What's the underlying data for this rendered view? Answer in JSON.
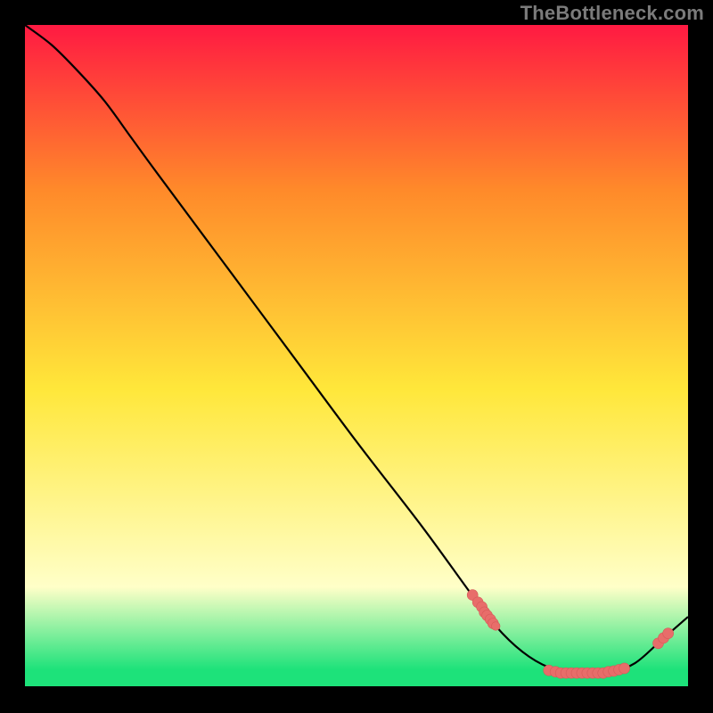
{
  "watermark": "TheBottleneck.com",
  "colors": {
    "background": "#000000",
    "gradient_top": "#ff1a42",
    "gradient_mid_upper": "#ff8a2a",
    "gradient_mid": "#ffe73a",
    "gradient_pale_yellow": "#ffffc8",
    "gradient_green": "#1de27a",
    "line": "#000000",
    "point_fill": "#e86d6a",
    "point_stroke": "#d65a58",
    "watermark": "#7b7b7b"
  },
  "chart_data": {
    "type": "line",
    "title": "",
    "xlabel": "",
    "ylabel": "",
    "xlim": [
      0,
      100
    ],
    "ylim": [
      0,
      100
    ],
    "grid": false,
    "legend": false,
    "series": [
      {
        "name": "curve",
        "x": [
          0,
          4,
          8,
          12,
          16,
          20,
          30,
          40,
          50,
          60,
          68,
          72,
          76,
          80,
          84,
          88,
          92,
          96,
          100
        ],
        "y": [
          100,
          97,
          93,
          88.5,
          83,
          77.5,
          64,
          50.5,
          37,
          24,
          13,
          8,
          4.5,
          2.5,
          2,
          2,
          3.5,
          7,
          10.5
        ]
      }
    ],
    "points": [
      {
        "x": 67.5,
        "y": 13.8,
        "r": 1.0
      },
      {
        "x": 68.3,
        "y": 12.7,
        "r": 1.0
      },
      {
        "x": 68.9,
        "y": 12.0,
        "r": 1.0
      },
      {
        "x": 69.3,
        "y": 11.2,
        "r": 1.0
      },
      {
        "x": 69.7,
        "y": 10.7,
        "r": 1.0
      },
      {
        "x": 70.2,
        "y": 10.1,
        "r": 1.0
      },
      {
        "x": 70.6,
        "y": 9.5,
        "r": 1.0
      },
      {
        "x": 71.0,
        "y": 9.1,
        "r": 0.8
      },
      {
        "x": 79.0,
        "y": 2.4,
        "r": 1.0
      },
      {
        "x": 80.0,
        "y": 2.2,
        "r": 1.0
      },
      {
        "x": 80.8,
        "y": 2.0,
        "r": 1.0
      },
      {
        "x": 81.6,
        "y": 2.0,
        "r": 1.0
      },
      {
        "x": 82.4,
        "y": 2.0,
        "r": 1.0
      },
      {
        "x": 83.2,
        "y": 2.0,
        "r": 1.0
      },
      {
        "x": 84.0,
        "y": 2.0,
        "r": 1.0
      },
      {
        "x": 84.8,
        "y": 2.0,
        "r": 1.0
      },
      {
        "x": 85.6,
        "y": 2.0,
        "r": 1.0
      },
      {
        "x": 86.4,
        "y": 2.0,
        "r": 1.0
      },
      {
        "x": 87.2,
        "y": 2.0,
        "r": 1.0
      },
      {
        "x": 88.0,
        "y": 2.2,
        "r": 1.0
      },
      {
        "x": 88.8,
        "y": 2.3,
        "r": 1.0
      },
      {
        "x": 89.6,
        "y": 2.5,
        "r": 1.0
      },
      {
        "x": 90.4,
        "y": 2.7,
        "r": 1.0
      },
      {
        "x": 95.5,
        "y": 6.5,
        "r": 1.0
      },
      {
        "x": 96.3,
        "y": 7.3,
        "r": 1.0
      },
      {
        "x": 97.0,
        "y": 8.0,
        "r": 1.0
      }
    ]
  }
}
